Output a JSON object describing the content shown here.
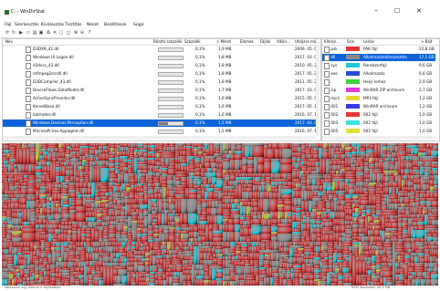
{
  "window": {
    "title": "C: - WinDirStat",
    "icon": "windirstat-icon",
    "minimize_glyph": "–",
    "maximize_glyph": "☐",
    "close_glyph": "✕"
  },
  "menu": [
    "Fájl",
    "Szerkesztés",
    "Kiválasztás",
    "Tisztítás",
    "Nézet",
    "Beállítások",
    "Súgó"
  ],
  "toolbar": {
    "icons": [
      "refresh-icon",
      "refresh-selected-icon",
      "play-icon",
      "open-folder-icon",
      "copy-path-icon",
      "explorer-icon",
      "delete-icon",
      "cancel-icon",
      "command-prompt-icon",
      "properties-icon",
      "zoom-in-icon",
      "zoom-out-icon",
      "help-icon"
    ],
    "glyphs": [
      "⟳",
      "↻",
      "▶",
      "▭",
      "▤",
      "▣",
      "♻",
      "✕",
      "▢",
      "◻",
      "⊕",
      "⊖",
      "?"
    ]
  },
  "tree": {
    "columns": [
      "Név",
      "Részfa százalék",
      "Százalék",
      "> Méret",
      "Elemek",
      "Fájlok",
      "Alkön...",
      "Utoljára mó..."
    ],
    "rows": [
      {
        "name": "D3DX9_42.dll",
        "pct": "0,1%",
        "size": "1,9 MB",
        "date": "2009. 05. 0",
        "fill": 0.0
      },
      {
        "name": "Windows.UI.Logon.dll",
        "pct": "0,1%",
        "size": "1,8 MB",
        "date": "2017. 03. 0",
        "fill": 0.0
      },
      {
        "name": "d3dcsx_43.dll",
        "pct": "0,1%",
        "size": "1,8 MB",
        "date": "2010. 05. 2",
        "fill": 0.0
      },
      {
        "name": "mfmpeg2srcdll.dll",
        "pct": "0,1%",
        "size": "1,8 MB",
        "date": "2017. 05. 2",
        "fill": 0.0
      },
      {
        "name": "D3DCompiler_41.dll",
        "pct": "0,1%",
        "size": "1,8 MB",
        "date": "2011. 05. 2",
        "fill": 0.0
      },
      {
        "name": "DeviceFlows.DataModel.dll",
        "pct": "0,1%",
        "size": "1,7 MB",
        "date": "2017. 03. 0",
        "fill": 0.0
      },
      {
        "name": "ActiveSyncProvider.dll",
        "pct": "0,1%",
        "size": "1,6 MB",
        "date": "2015. 05. 0",
        "fill": 0.0
      },
      {
        "name": "KernelBase.dll",
        "pct": "0,1%",
        "size": "1,6 MB",
        "date": "2017. 05. 1",
        "fill": 0.0
      },
      {
        "name": "batmeter.dll",
        "pct": "0,1%",
        "size": "1,6 MB",
        "date": "2016. 07. 1",
        "fill": 0.0
      },
      {
        "name": "Windows.Devices.Perception.dll",
        "pct": "0,1%",
        "size": "1,5 MB",
        "date": "2017. 03. 0",
        "fill": 0.4,
        "selected": true
      },
      {
        "name": "Microsoft.Uev.Appagent.dll",
        "pct": "0,1%",
        "size": "1,5 MB",
        "date": "2016. 07. 1",
        "fill": 0.0
      }
    ]
  },
  "extensions": {
    "columns": [
      "Kiterje...",
      "Szín",
      "Leírás",
      "> Bájt"
    ],
    "rows": [
      {
        "ext": ".psk",
        "color": "#e8323c",
        "desc": "PAK fájl",
        "bytes": "22,8 GB"
      },
      {
        "ext": ".dll",
        "color": "#8a8a8a",
        "desc": "Alkalmazáskiterjesztés",
        "bytes": "17,1 GB",
        "selected": true
      },
      {
        "ext": ".sys",
        "color": "#20c8d8",
        "desc": "Rendszerfájl",
        "bytes": "9,6 GB"
      },
      {
        "ext": ".exe",
        "color": "#2a4bd8",
        "desc": "Alkalmazás",
        "bytes": "6,6 GB"
      },
      {
        "ext": ".",
        "color": "#3ad13a",
        "desc": "Helyi lemez",
        "bytes": "2,9 GB"
      },
      {
        "ext": ".zip",
        "color": "#e03ad8",
        "desc": "WinRAR ZIP archívum",
        "bytes": "2,7 GB"
      },
      {
        "ext": ".mp3",
        "color": "#e8d83a",
        "desc": "MP3 fájl",
        "bytes": "1,2 GB"
      },
      {
        "ext": ".001",
        "color": "#3a3ae0",
        "desc": "WinRAR archívum",
        "bytes": "1,2 GB"
      },
      {
        "ext": ".002",
        "color": "#e03a3a",
        "desc": "002 fájl",
        "bytes": "1,0 GB"
      },
      {
        "ext": ".003",
        "color": "#3ae0e0",
        "desc": "002 fájl",
        "bytes": "1,0 GB"
      },
      {
        "ext": ".005",
        "color": "#e0e03a",
        "desc": "005 fájl",
        "bytes": "1,0 GB"
      }
    ]
  },
  "status": {
    "left": "Válasszon egy elemet a fájllistában",
    "right": "RAM használat: 46,5 MB"
  },
  "colors": {
    "treemap_red": "#d93a3a",
    "treemap_grey": "#8a8a8a",
    "treemap_cyan": "#20c8d8",
    "treemap_bg": "#2a2a2a",
    "selection": "#0a64d8"
  }
}
